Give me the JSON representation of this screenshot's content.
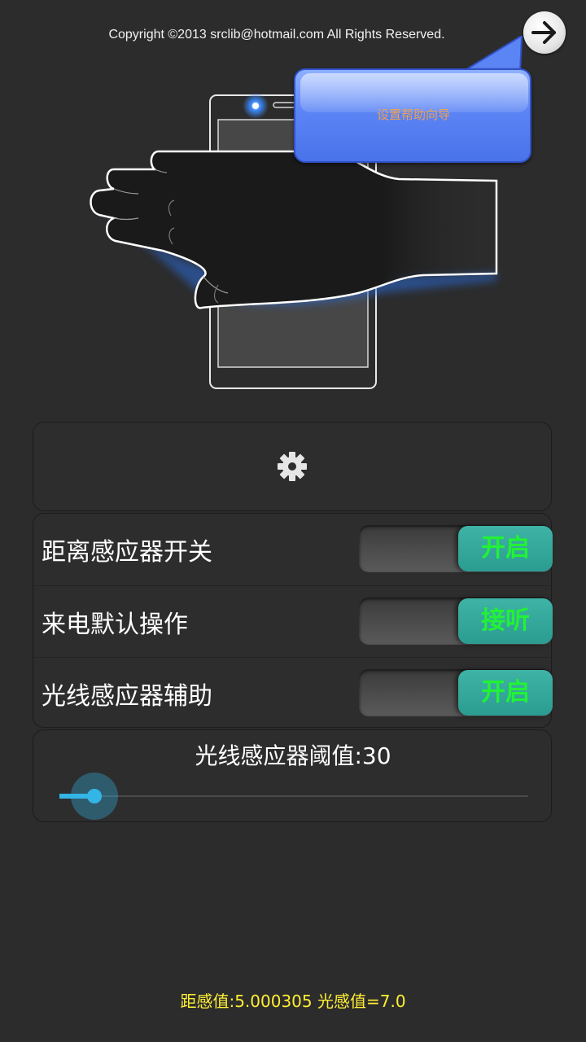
{
  "header": {
    "copyright": "Copyright ©2013 srclib@hotmail.com All Rights Reserved.",
    "next_icon": "arrow-right-icon"
  },
  "tooltip": {
    "text": "设置帮助向导"
  },
  "gear_panel": {
    "icon": "gear-icon"
  },
  "settings": {
    "rows": [
      {
        "label": "距离感应器开关",
        "toggle_text": "开启"
      },
      {
        "label": "来电默认操作",
        "toggle_text": "接听"
      },
      {
        "label": "光线感应器辅助",
        "toggle_text": "开启"
      }
    ]
  },
  "slider": {
    "label": "光线感应器阈值:30",
    "value": 30,
    "min": 0,
    "max": 500,
    "accent": "#33b5e5"
  },
  "footer": {
    "readout": "距感值:5.000305 光感值=7.0"
  },
  "colors": {
    "background": "#2c2c2c",
    "toggle_on": "#2b9c90",
    "toggle_text": "#22f235",
    "tooltip": "#4a73ea",
    "readout": "#ffee33"
  }
}
